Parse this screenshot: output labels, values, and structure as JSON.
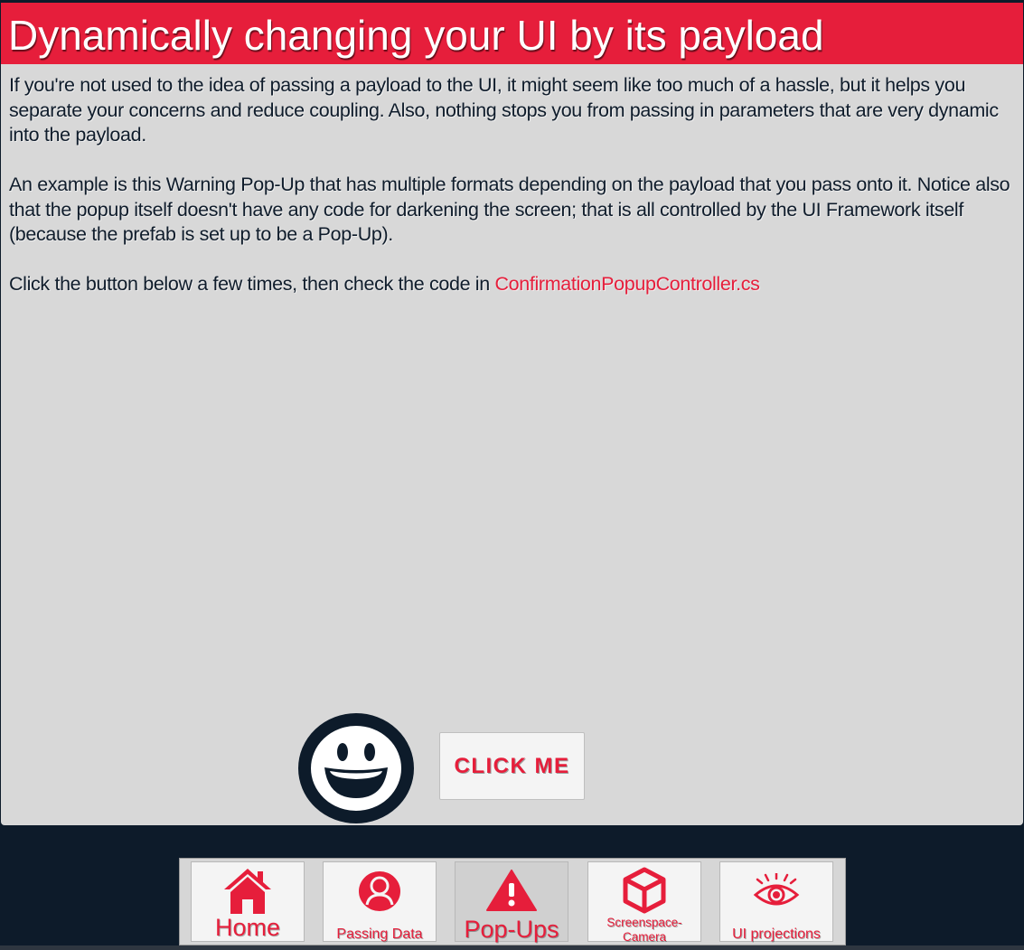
{
  "header": {
    "title": "Dynamically changing your UI by its payload"
  },
  "content": {
    "paragraph_1": "If you're not used to the idea of passing a payload to the UI, it might seem like too much of a hassle, but it helps you separate your concerns and reduce coupling. Also, nothing stops you from passing in parameters that are very dynamic into the payload.",
    "paragraph_2": "An example is this Warning Pop-Up that has multiple formats depending on the payload that you pass onto it. Notice also that the popup itself doesn't have any code for darkening the screen; that is all controlled by the UI Framework itself (because the prefab is set up to be a Pop-Up).",
    "paragraph_3_prefix": "Click the button below a few times, then check the code in ",
    "code_link": "ConfirmationPopupController.cs"
  },
  "actions": {
    "click_me_label": "CLICK ME"
  },
  "nav": {
    "home_label": "Home",
    "passing_data_label": "Passing Data",
    "popups_label": "Pop-Ups",
    "screenspace_label_line1": "Screenspace-",
    "screenspace_label_line2": "Camera",
    "ui_projections_label": "UI projections",
    "active_tab": "Pop-Ups"
  },
  "icons": {
    "smiley": "smiley-face-icon",
    "home": "house-icon",
    "passing_data": "user-icon",
    "popups": "warning-icon",
    "screenspace": "cube-icon",
    "ui_projections": "eye-icon"
  },
  "colors": {
    "accent": "#e61e3b",
    "panel_background": "#d8d8d8",
    "app_background": "#0d1b2a",
    "text": "#0f1c2b"
  }
}
